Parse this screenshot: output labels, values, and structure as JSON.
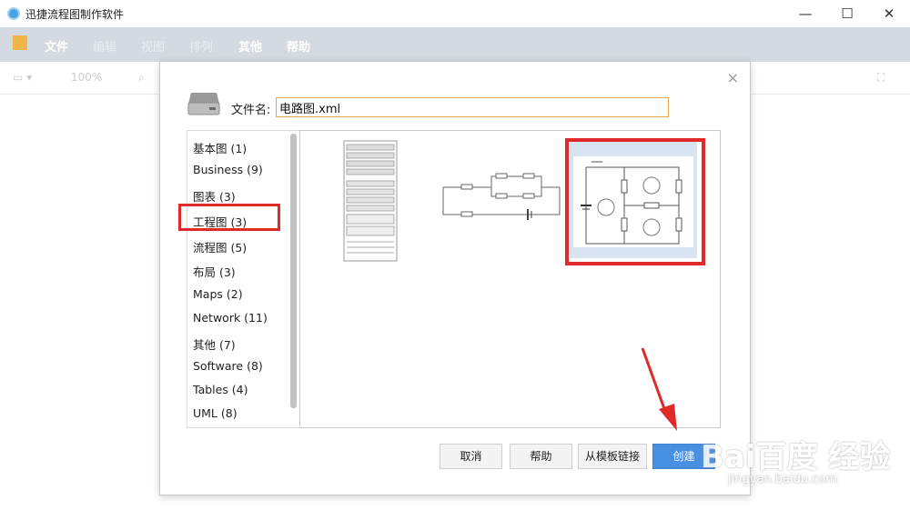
{
  "window": {
    "title": "迅捷流程图制作软件",
    "minimize": "—",
    "maximize": "☐",
    "close": "✕"
  },
  "menu": {
    "file": "文件",
    "edit": "编辑",
    "view": "视图",
    "arrange": "排列",
    "other": "其他",
    "help": "帮助"
  },
  "toolbar": {
    "zoom": "100%"
  },
  "dialog": {
    "filename_label": "文件名:",
    "filename_value": "电路图.xml",
    "close": "×",
    "categories": [
      "基本图 (1)",
      "Business (9)",
      "图表 (3)",
      "工程图 (3)",
      "流程图 (5)",
      "布局 (3)",
      "Maps (2)",
      "Network (11)",
      "其他 (7)",
      "Software (8)",
      "Tables (4)",
      "UML (8)"
    ],
    "selected_category": "工程图 (3)",
    "templates": [
      "rack-diagram",
      "resistor-circuit",
      "mesh-circuit"
    ],
    "buttons": {
      "cancel": "取消",
      "help": "帮助",
      "from_template_link": "从模板链接",
      "create": "创建"
    }
  },
  "watermark": {
    "brand": "Bai百度 经验",
    "url": "jingyan.baidu.com"
  },
  "colors": {
    "accent": "#4a90e2",
    "highlight": "#e02a2a",
    "menubar": "#d4dae1"
  }
}
